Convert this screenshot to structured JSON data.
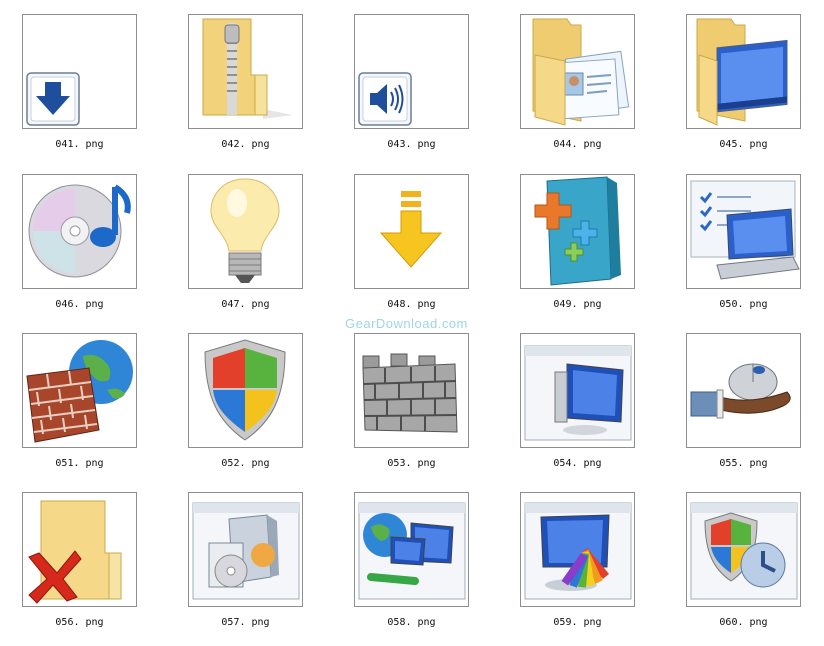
{
  "gallery": {
    "items": [
      {
        "file": "041. png",
        "icon": "download-arrow-icon"
      },
      {
        "file": "042. png",
        "icon": "zip-folder-icon"
      },
      {
        "file": "043. png",
        "icon": "speaker-volume-icon"
      },
      {
        "file": "044. png",
        "icon": "contacts-folder-icon"
      },
      {
        "file": "045. png",
        "icon": "desktop-folder-icon"
      },
      {
        "file": "046. png",
        "icon": "music-cd-icon"
      },
      {
        "file": "047. png",
        "icon": "light-bulb-icon"
      },
      {
        "file": "048. png",
        "icon": "install-arrow-icon"
      },
      {
        "file": "049. png",
        "icon": "add-ons-box-icon"
      },
      {
        "file": "050. png",
        "icon": "laptop-checklist-icon"
      },
      {
        "file": "051. png",
        "icon": "firewall-globe-icon"
      },
      {
        "file": "052. png",
        "icon": "security-shield-icon"
      },
      {
        "file": "053. png",
        "icon": "stone-wall-icon"
      },
      {
        "file": "054. png",
        "icon": "monitor-window-icon"
      },
      {
        "file": "055. png",
        "icon": "hand-mouse-icon"
      },
      {
        "file": "056. png",
        "icon": "folder-delete-icon"
      },
      {
        "file": "057. png",
        "icon": "programs-cd-icon"
      },
      {
        "file": "058. png",
        "icon": "network-globe-icon"
      },
      {
        "file": "059. png",
        "icon": "display-color-icon"
      },
      {
        "file": "060. png",
        "icon": "shield-clock-icon"
      }
    ]
  },
  "watermark": {
    "text": "GearDownload.com"
  },
  "colors": {
    "border": "#8e8e8e",
    "watermark": "#9ed6e6"
  }
}
